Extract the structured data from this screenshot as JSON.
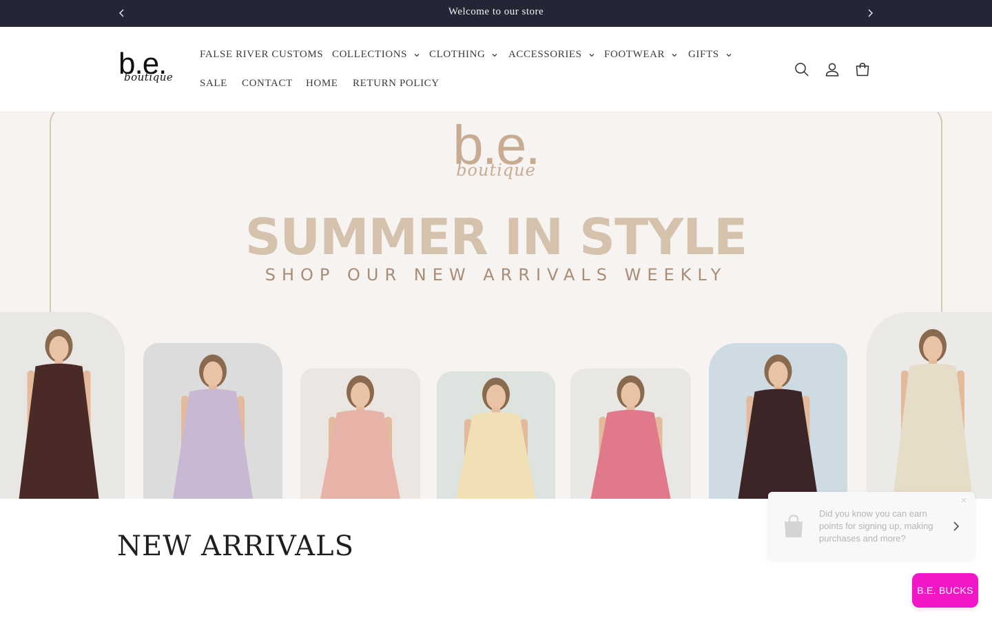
{
  "announcement": {
    "message": "Welcome to our store",
    "prev_icon": "chevron-left-icon",
    "next_icon": "chevron-right-icon"
  },
  "header": {
    "logo": {
      "main": "b.e.",
      "script": "boutique"
    },
    "nav": [
      {
        "label": "FALSE RIVER CUSTOMS",
        "dropdown": false
      },
      {
        "label": "COLLECTIONS",
        "dropdown": true
      },
      {
        "label": "CLOTHING",
        "dropdown": true
      },
      {
        "label": "ACCESSORIES",
        "dropdown": true
      },
      {
        "label": "FOOTWEAR",
        "dropdown": true
      },
      {
        "label": "GIFTS",
        "dropdown": true
      },
      {
        "label": "SALE",
        "dropdown": false
      },
      {
        "label": "CONTACT",
        "dropdown": false
      },
      {
        "label": "HOME",
        "dropdown": false
      },
      {
        "label": "RETURN POLICY",
        "dropdown": false
      }
    ],
    "icons": [
      "search-icon",
      "account-icon",
      "cart-icon"
    ]
  },
  "hero": {
    "logo": {
      "main": "b.e.",
      "script": "boutique"
    },
    "title": "SUMMER IN STYLE",
    "subtitle": "SHOP OUR NEW ARRIVALS WEEKLY",
    "photos": [
      {
        "outfit": "#4a2a26",
        "wall": "#e9e7e4"
      },
      {
        "outfit": "#c9b8d2",
        "wall": "#dcdcdc"
      },
      {
        "outfit": "#e7b3a8",
        "wall": "#ebe6e1"
      },
      {
        "outfit": "#f1dfb6",
        "wall": "#dde3df"
      },
      {
        "outfit": "#e07a8a",
        "wall": "#e9e7e4"
      },
      {
        "outfit": "#3b2526",
        "wall": "#cfdbe3"
      },
      {
        "outfit": "#e6ddc9",
        "wall": "#eceae7"
      }
    ]
  },
  "section": {
    "title": "NEW ARRIVALS"
  },
  "popup": {
    "text": "Did you know you can earn points for signing up, making purchases and more?",
    "close": "×"
  },
  "rewards_button": {
    "label": "B.E. BUCKS"
  },
  "colors": {
    "announcement_bg": "#232634",
    "hero_bg": "#f7f3f0",
    "hero_accent": "#d5c2ad",
    "rewards_pink": "#f216c9"
  }
}
